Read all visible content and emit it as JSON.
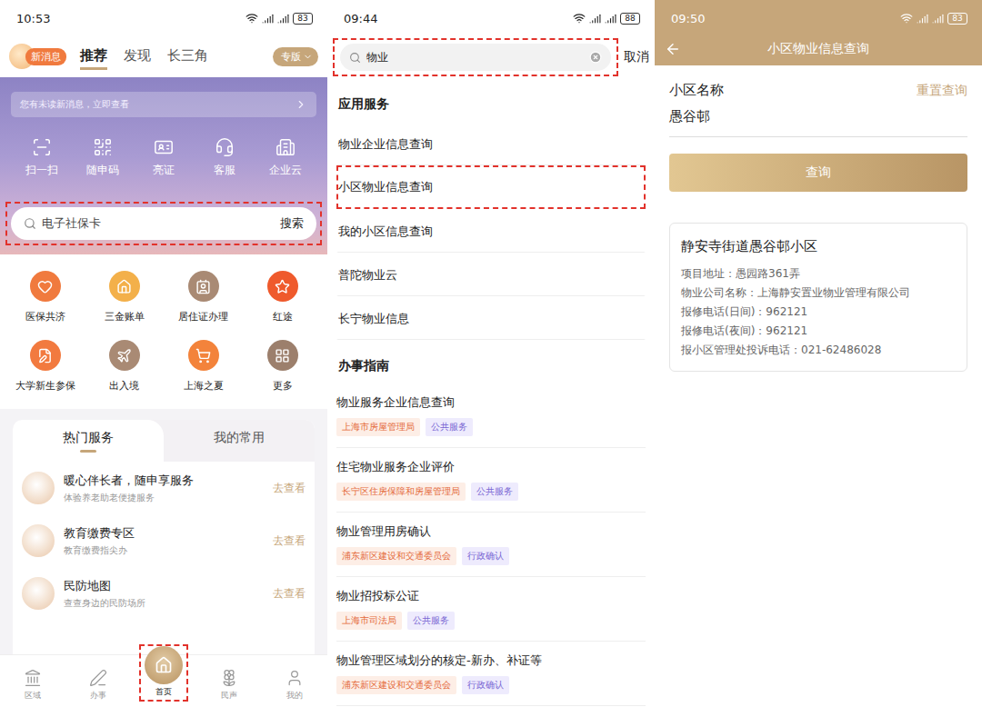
{
  "home": {
    "status_bar": {
      "time": "10:53",
      "battery": "83"
    },
    "new_message_badge": "新消息",
    "tabs": [
      {
        "label": "推荐",
        "selected": true
      },
      {
        "label": "发现",
        "selected": false
      },
      {
        "label": "长三角",
        "selected": false
      }
    ],
    "edition_button": "专版",
    "notice": "您有未读新消息，立即查看",
    "quick_actions": [
      "扫一扫",
      "随申码",
      "亮证",
      "客服",
      "企业云"
    ],
    "search": {
      "placeholder": "电子社保卡",
      "button": "搜索",
      "highlighted": true
    },
    "services": [
      {
        "label": "医保共济",
        "color": "#f07a3e"
      },
      {
        "label": "三金账单",
        "color": "#f3b04a"
      },
      {
        "label": "居住证办理",
        "color": "#a98a74"
      },
      {
        "label": "红途",
        "color": "#ef5a2c"
      },
      {
        "label": "大学新生参保",
        "color": "#f27a3f"
      },
      {
        "label": "出入境",
        "color": "#a98a74"
      },
      {
        "label": "上海之夏",
        "color": "#f3833b"
      },
      {
        "label": "更多",
        "color": "#9c7f6c"
      }
    ],
    "service_tabs": [
      {
        "label": "热门服务",
        "selected": true
      },
      {
        "label": "我的常用",
        "selected": false
      }
    ],
    "hot_services": [
      {
        "title": "暖心伴长者，随申享服务",
        "subtitle": "体验养老助老便捷服务",
        "action": "去查看"
      },
      {
        "title": "教育缴费专区",
        "subtitle": "教育缴费指尖办",
        "action": "去查看"
      },
      {
        "title": "民防地图",
        "subtitle": "查查身边的民防场所",
        "action": "去查看"
      }
    ],
    "nav": [
      {
        "label": "区域",
        "selected": false,
        "highlighted": false
      },
      {
        "label": "办事",
        "selected": false,
        "highlighted": false
      },
      {
        "label": "首页",
        "selected": true,
        "highlighted": true
      },
      {
        "label": "民声",
        "selected": false,
        "highlighted": false
      },
      {
        "label": "我的",
        "selected": false,
        "highlighted": false
      }
    ]
  },
  "search_screen": {
    "status_bar": {
      "time": "09:44",
      "battery": "88"
    },
    "query": "物业",
    "query_highlighted": true,
    "cancel": "取消",
    "apps_heading": "应用服务",
    "apps": [
      {
        "label": "物业企业信息查询",
        "highlighted": false
      },
      {
        "label": "小区物业信息查询",
        "highlighted": true
      },
      {
        "label": "我的小区信息查询",
        "highlighted": false
      },
      {
        "label": "普陀物业云",
        "highlighted": false
      },
      {
        "label": "长宁物业信息",
        "highlighted": false
      }
    ],
    "guides_heading": "办事指南",
    "guides": [
      {
        "title": "物业服务企业信息查询",
        "tags": [
          {
            "label": "上海市房屋管理局",
            "kind": "department"
          },
          {
            "label": "公共服务",
            "kind": "category"
          }
        ]
      },
      {
        "title": "住宅物业服务企业评价",
        "tags": [
          {
            "label": "长宁区住房保障和房屋管理局",
            "kind": "department"
          },
          {
            "label": "公共服务",
            "kind": "category"
          }
        ]
      },
      {
        "title": "物业管理用房确认",
        "tags": [
          {
            "label": "浦东新区建设和交通委员会",
            "kind": "department"
          },
          {
            "label": "行政确认",
            "kind": "category"
          }
        ]
      },
      {
        "title": "物业招投标公证",
        "tags": [
          {
            "label": "上海市司法局",
            "kind": "department"
          },
          {
            "label": "公共服务",
            "kind": "category"
          }
        ]
      },
      {
        "title": "物业管理区域划分的核定-新办、补证等",
        "tags": [
          {
            "label": "浦东新区建设和交通委员会",
            "kind": "department"
          },
          {
            "label": "行政确认",
            "kind": "category"
          }
        ]
      }
    ]
  },
  "detail_screen": {
    "status_bar": {
      "time": "09:50",
      "battery": "83"
    },
    "title": "小区物业信息查询",
    "field_label": "小区名称",
    "reset": "重置查询",
    "field_value": "愚谷邨",
    "submit": "查询",
    "result": {
      "name": "静安寺街道愚谷邨小区",
      "lines": [
        "项目地址：愚园路361弄",
        "物业公司名称：上海静安置业物业管理有限公司",
        "报修电话(日间)：962121",
        "报修电话(夜间)：962121",
        "报小区管理处投诉电话：021-62486028"
      ]
    }
  }
}
